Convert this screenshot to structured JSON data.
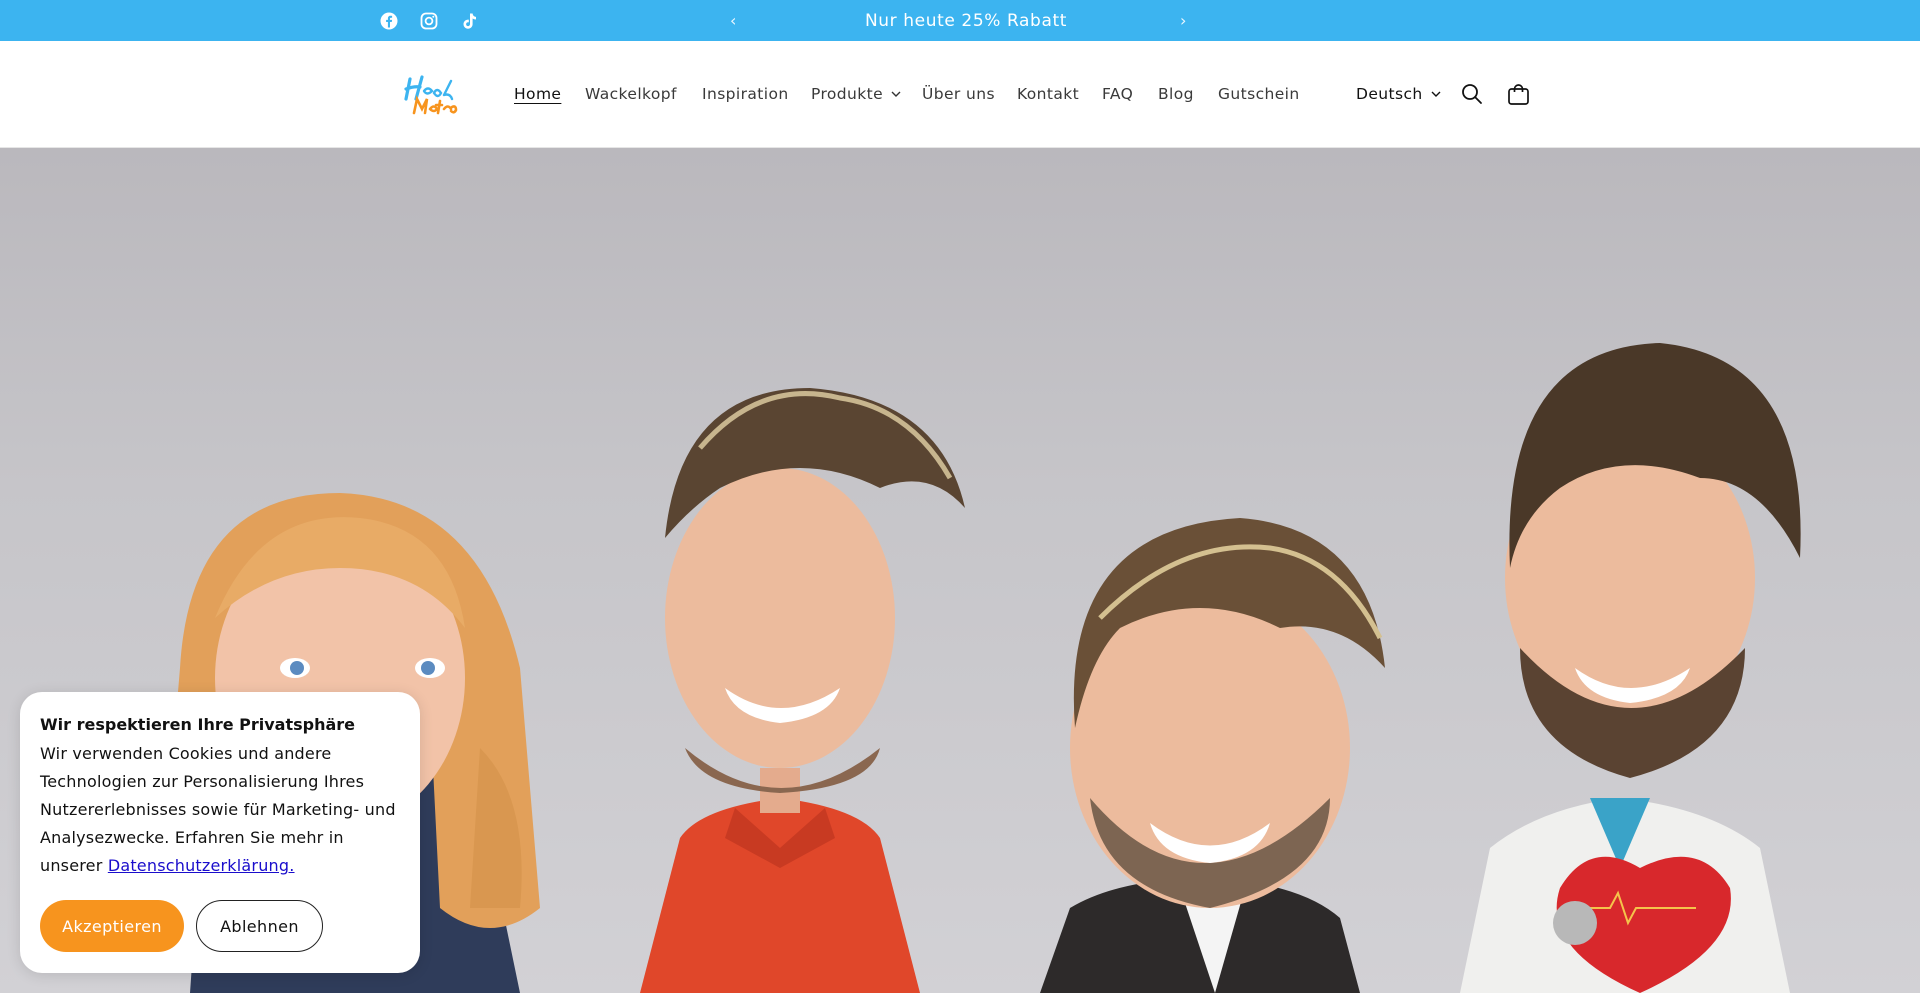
{
  "announcement": {
    "text": "Nur heute 25% Rabatt",
    "prev_label": "‹",
    "next_label": "›",
    "social": [
      "facebook-icon",
      "instagram-icon",
      "tiktok-icon"
    ]
  },
  "header": {
    "logo_alt": "Head Mates",
    "nav": [
      {
        "label": "Home",
        "active": true
      },
      {
        "label": "Wackelkopf"
      },
      {
        "label": "Inspiration"
      },
      {
        "label": "Produkte",
        "has_dropdown": true
      },
      {
        "label": "Über uns"
      },
      {
        "label": "Kontakt"
      },
      {
        "label": "FAQ"
      },
      {
        "label": "Blog"
      },
      {
        "label": "Gutschein"
      }
    ],
    "language": "Deutsch",
    "icons": [
      "search-icon",
      "cart-icon"
    ]
  },
  "cookie": {
    "title": "Wir respektieren Ihre Privatsphäre",
    "body": "Wir verwenden Cookies und andere Technologien zur Personalisierung Ihres Nutzererlebnisses sowie für Marketing- und Analysezwecke. Erfahren Sie mehr in unserer",
    "link": "Datenschutzerklärung.",
    "accept": "Akzeptieren",
    "decline": "Ablehnen"
  },
  "colors": {
    "announcement_bg": "#3cb4f0",
    "accept_button": "#f7941e",
    "link": "#1a0dcc"
  }
}
